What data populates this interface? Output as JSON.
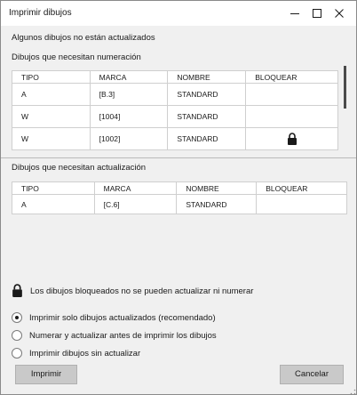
{
  "window": {
    "title": "Imprimir dibujos"
  },
  "message": "Algunos dibujos no están actualizados",
  "numbering": {
    "label": "Dibujos que necesitan numeración",
    "columns": [
      "TIPO",
      "MARCA",
      "NOMBRE",
      "BLOQUEAR"
    ],
    "rows": [
      {
        "tipo": "A",
        "marca": "[B.3]",
        "nombre": "STANDARD",
        "locked": false
      },
      {
        "tipo": "W",
        "marca": "[1004]",
        "nombre": "STANDARD",
        "locked": false
      },
      {
        "tipo": "W",
        "marca": "[1002]",
        "nombre": "STANDARD",
        "locked": true
      }
    ]
  },
  "updating": {
    "label": "Dibujos que necesitan actualización",
    "columns": [
      "TIPO",
      "MARCA",
      "NOMBRE",
      "BLOQUEAR"
    ],
    "rows": [
      {
        "tipo": "A",
        "marca": "[C.6]",
        "nombre": "STANDARD",
        "locked": false
      }
    ]
  },
  "locked_note": "Los dibujos bloqueados no se pueden actualizar ni numerar",
  "options": [
    {
      "label": "Imprimir solo dibujos actualizados (recomendado)",
      "selected": true
    },
    {
      "label": "Numerar y actualizar antes de imprimir los dibujos",
      "selected": false
    },
    {
      "label": "Imprimir dibujos sin actualizar",
      "selected": false
    }
  ],
  "buttons": {
    "print": "Imprimir",
    "cancel": "Cancelar"
  },
  "icons": {
    "minimize": "minimize-icon",
    "maximize": "maximize-icon",
    "close": "close-icon",
    "lock": "lock-icon"
  }
}
